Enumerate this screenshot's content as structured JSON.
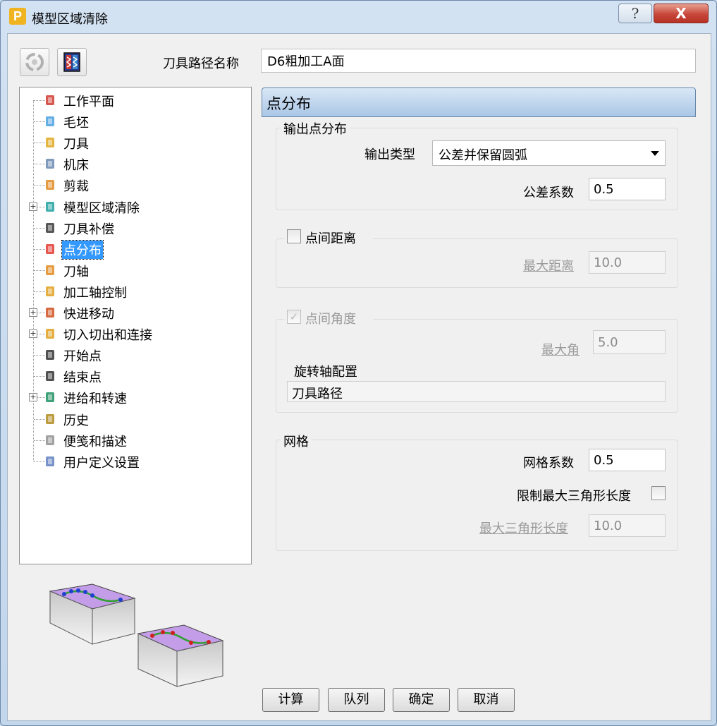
{
  "window": {
    "app_icon_letter": "P",
    "title": "模型区域清除",
    "help_label": "?",
    "close_label": "X"
  },
  "toolpath": {
    "name_label": "刀具路径名称",
    "name_value": "D6粗加工A面"
  },
  "tree": {
    "items": [
      {
        "label": "工作平面",
        "icon": "workplane-icon",
        "expandable": false
      },
      {
        "label": "毛坯",
        "icon": "block-icon",
        "expandable": false
      },
      {
        "label": "刀具",
        "icon": "tool-icon",
        "expandable": false
      },
      {
        "label": "机床",
        "icon": "machine-icon",
        "expandable": false
      },
      {
        "label": "剪裁",
        "icon": "limit-icon",
        "expandable": false
      },
      {
        "label": "模型区域清除",
        "icon": "layers-icon",
        "expandable": true
      },
      {
        "label": "刀具补偿",
        "icon": "compensation-icon",
        "expandable": false
      },
      {
        "label": "点分布",
        "icon": "point-distribution-icon",
        "expandable": false,
        "selected": true
      },
      {
        "label": "刀轴",
        "icon": "tool-axis-icon",
        "expandable": false
      },
      {
        "label": "加工轴控制",
        "icon": "axis-control-icon",
        "expandable": false
      },
      {
        "label": "快进移动",
        "icon": "rapid-move-icon",
        "expandable": true
      },
      {
        "label": "切入切出和连接",
        "icon": "leads-links-icon",
        "expandable": true
      },
      {
        "label": "开始点",
        "icon": "start-point-icon",
        "expandable": false
      },
      {
        "label": "结束点",
        "icon": "end-point-icon",
        "expandable": false
      },
      {
        "label": "进给和转速",
        "icon": "feeds-speeds-icon",
        "expandable": true
      },
      {
        "label": "历史",
        "icon": "history-icon",
        "expandable": false
      },
      {
        "label": "便笺和描述",
        "icon": "notes-icon",
        "expandable": false
      },
      {
        "label": "用户定义设置",
        "icon": "user-settings-icon",
        "expandable": false
      }
    ]
  },
  "panel": {
    "header": "点分布",
    "output": {
      "group_title": "输出点分布",
      "type_label": "输出类型",
      "type_value": "公差并保留圆弧",
      "tolerance_label": "公差系数",
      "tolerance_value": "0.5"
    },
    "point_distance": {
      "checkbox_label": "点间距离",
      "max_distance_label": "最大距离",
      "max_distance_value": "10.0"
    },
    "point_angle": {
      "checkbox_label": "点间角度",
      "checkmark": "✓",
      "max_angle_label": "最大角",
      "max_angle_value": "5.0",
      "rotary_label": "旋转轴配置",
      "rotary_value": "刀具路径"
    },
    "mesh": {
      "group_title": "网格",
      "factor_label": "网格系数",
      "factor_value": "0.5",
      "limit_label": "限制最大三角形长度",
      "max_tri_label": "最大三角形长度",
      "max_tri_value": "10.0"
    }
  },
  "buttons": {
    "calculate": "计算",
    "queue": "队列",
    "ok": "确定",
    "cancel": "取消"
  },
  "colors": {
    "selection": "#3399ff",
    "header_gradient_top": "#d9e7f6",
    "header_gradient_bottom": "#a9c6e6",
    "illustration_top": "#c39de8",
    "curve_blue_points": "#2040d0",
    "curve_red_points": "#d02020",
    "curve_green": "#30a030"
  }
}
